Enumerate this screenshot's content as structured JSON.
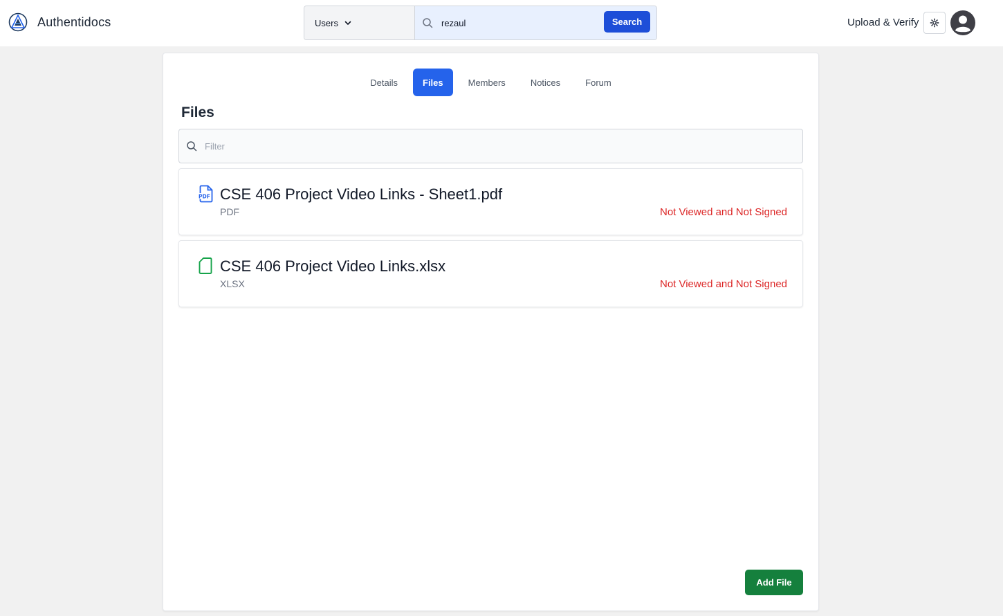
{
  "brand": {
    "name": "Authentidocs",
    "logo_icon": "authentidocs-logo-icon"
  },
  "search": {
    "scope_label": "Users",
    "query": "rezaul",
    "button_label": "Search"
  },
  "header": {
    "upload_label": "Upload & Verify",
    "settings_icon": "gear-icon",
    "avatar_icon": "user-avatar-icon"
  },
  "tabs": [
    {
      "label": "Details",
      "active": false
    },
    {
      "label": "Files",
      "active": true
    },
    {
      "label": "Members",
      "active": false
    },
    {
      "label": "Notices",
      "active": false
    },
    {
      "label": "Forum",
      "active": false
    }
  ],
  "files_section": {
    "title": "Files",
    "filter_placeholder": "Filter",
    "files": [
      {
        "name": "CSE 406 Project Video Links - Sheet1.pdf",
        "type": "PDF",
        "status": "Not Viewed and Not Signed",
        "icon": "pdf-file-icon"
      },
      {
        "name": "CSE 406 Project Video Links.xlsx",
        "type": "XLSX",
        "status": "Not Viewed and Not Signed",
        "icon": "spreadsheet-file-icon"
      }
    ],
    "add_button_label": "Add File"
  },
  "colors": {
    "primary": "#2563eb",
    "search_button": "#1d4ed8",
    "add_button": "#15803d",
    "status_text": "#dc2626",
    "pdf_icon": "#2563eb",
    "xlsx_icon": "#16a34a"
  }
}
